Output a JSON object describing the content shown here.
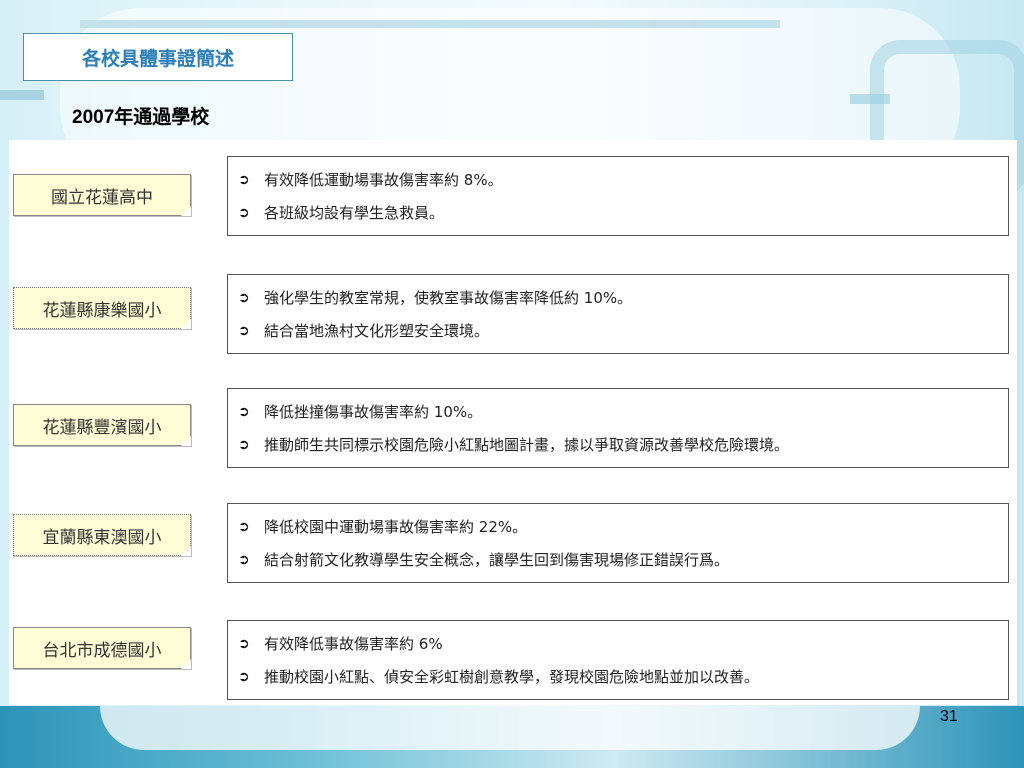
{
  "slide": {
    "title": "各校具體事證簡述",
    "subtitle": "2007年通過學校",
    "page_number": "31",
    "bullet_icon": "circled-arrow-right-icon"
  },
  "schools": [
    {
      "name": "國立花蓮高中",
      "points": [
        "有效降低運動場事故傷害率約 8%。",
        "各班級均設有學生急救員。"
      ]
    },
    {
      "name": "花蓮縣康樂國小",
      "points": [
        "強化學生的教室常規，使教室事故傷害率降低約 10%。",
        "結合當地漁村文化形塑安全環境。"
      ]
    },
    {
      "name": "花蓮縣豐濱國小",
      "points": [
        "降低挫撞傷事故傷害率約 10%。",
        "推動師生共同標示校園危險小紅點地圖計畫，據以爭取資源改善學校危險環境。"
      ]
    },
    {
      "name": "宜蘭縣東澳國小",
      "points": [
        "降低校園中運動場事故傷害率約 22%。",
        "結合射箭文化教導學生安全概念，讓學生回到傷害現場修正錯誤行爲。"
      ]
    },
    {
      "name": "台北市成德國小",
      "points": [
        "有效降低事故傷害率約 6%",
        "推動校園小紅點、偵安全彩虹樹創意教學，發現校園危險地點並加以改善。"
      ]
    }
  ]
}
